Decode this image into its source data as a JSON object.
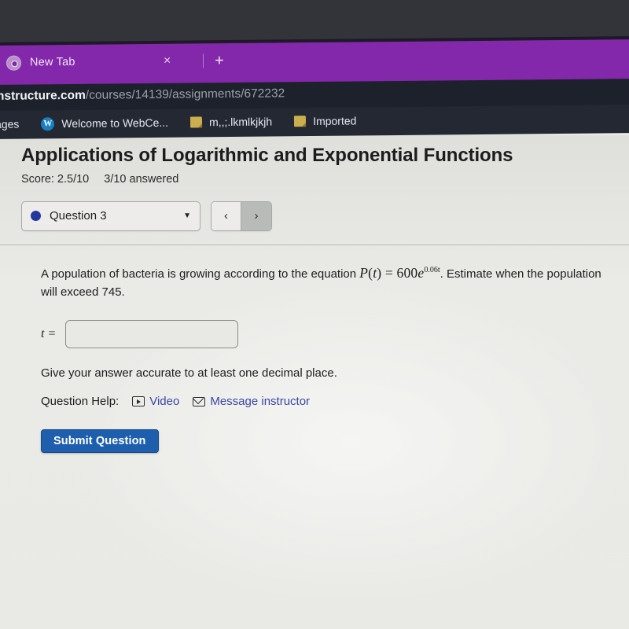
{
  "browser": {
    "tab": {
      "favicon": "chrome-icon",
      "title": "New Tab",
      "close_label": "×",
      "new_tab_label": "+"
    },
    "url": {
      "host": "nstructure.com",
      "path": "/courses/14139/assignments/672232"
    },
    "bookmarks": [
      {
        "icon": "none",
        "label": "ages"
      },
      {
        "icon": "webce-icon",
        "label": "Welcome to WebCe..."
      },
      {
        "icon": "folder-icon",
        "label": "m,,;.lkmlkjkjh"
      },
      {
        "icon": "folder-icon",
        "label": "Imported"
      }
    ]
  },
  "page": {
    "title": "Applications of Logarithmic and Exponential Functions",
    "score": "Score: 2.5/10",
    "answered": "3/10 answered",
    "question_selector": {
      "label": "Question 3",
      "status_color": "#24379c",
      "caret": "▼"
    },
    "nav": {
      "prev_label": "‹",
      "next_label": "›"
    },
    "question": {
      "text_before": "A population of bacteria is growing according to the equation",
      "equation": {
        "function": "P",
        "variable": "t",
        "equals": "=",
        "coefficient": "600",
        "base": "e",
        "exponent": "0.06t"
      },
      "text_after": ". Estimate when the population will exceed 745.",
      "answer_label": "t =",
      "answer_value": "",
      "answer_placeholder": "",
      "hint": "Give your answer accurate to at least one decimal place."
    },
    "help": {
      "label": "Question Help:",
      "video_label": "Video",
      "message_label": "Message instructor",
      "link_color": "#3b46a3"
    },
    "submit_label": "Submit Question",
    "submit_color": "#1e5fad"
  }
}
